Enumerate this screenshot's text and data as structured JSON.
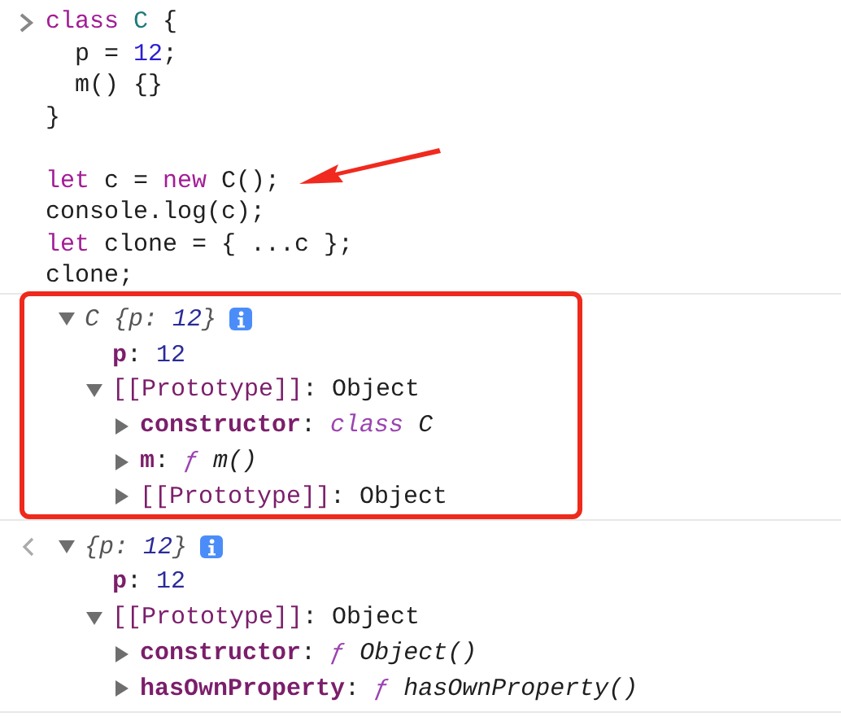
{
  "input": {
    "lines": [
      {
        "segments": [
          {
            "text": "class ",
            "kind": "keyword"
          },
          {
            "text": "C",
            "kind": "name"
          },
          {
            "text": " {",
            "kind": "plain"
          }
        ]
      },
      {
        "segments": [
          {
            "text": "  p = ",
            "kind": "plain"
          },
          {
            "text": "12",
            "kind": "number"
          },
          {
            "text": ";",
            "kind": "plain"
          }
        ]
      },
      {
        "segments": [
          {
            "text": "  m() {}",
            "kind": "plain"
          }
        ]
      },
      {
        "segments": [
          {
            "text": "}",
            "kind": "plain"
          }
        ]
      },
      {
        "gap_before": true,
        "segments": [
          {
            "text": "let",
            "kind": "keyword"
          },
          {
            "text": " c = ",
            "kind": "plain"
          },
          {
            "text": "new",
            "kind": "keyword"
          },
          {
            "text": " C();",
            "kind": "plain"
          }
        ]
      },
      {
        "segments": [
          {
            "text": "console.log(c);",
            "kind": "plain"
          }
        ]
      },
      {
        "segments": [
          {
            "text": "let",
            "kind": "keyword"
          },
          {
            "text": " clone = { ...c };",
            "kind": "plain"
          }
        ]
      },
      {
        "segments": [
          {
            "text": "clone;",
            "kind": "plain"
          }
        ]
      }
    ]
  },
  "outputs": [
    {
      "kind": "log",
      "tree": {
        "expanded": true,
        "info": true,
        "parts": [
          {
            "text": "C {p: ",
            "kind": "preview"
          },
          {
            "text": "12",
            "kind": "preview-number"
          },
          {
            "text": "}",
            "kind": "preview"
          }
        ],
        "children": [
          {
            "parts": [
              {
                "text": "p",
                "kind": "key"
              },
              {
                "text": ": ",
                "kind": "plain"
              },
              {
                "text": "12",
                "kind": "number"
              }
            ]
          },
          {
            "expanded": true,
            "parts": [
              {
                "text": "[[Prototype]]",
                "kind": "internal"
              },
              {
                "text": ": Object",
                "kind": "plain"
              }
            ],
            "children": [
              {
                "expanded": false,
                "parts": [
                  {
                    "text": "constructor",
                    "kind": "key"
                  },
                  {
                    "text": ": ",
                    "kind": "plain"
                  },
                  {
                    "text": "class",
                    "kind": "fn"
                  },
                  {
                    "text": " C",
                    "kind": "fn-name"
                  }
                ]
              },
              {
                "expanded": false,
                "parts": [
                  {
                    "text": "m",
                    "kind": "key"
                  },
                  {
                    "text": ": ",
                    "kind": "plain"
                  },
                  {
                    "text": "ƒ",
                    "kind": "fn"
                  },
                  {
                    "text": " m()",
                    "kind": "fn-name"
                  }
                ]
              },
              {
                "expanded": false,
                "parts": [
                  {
                    "text": "[[Prototype]]",
                    "kind": "internal"
                  },
                  {
                    "text": ": Object",
                    "kind": "plain"
                  }
                ]
              }
            ]
          }
        ]
      }
    },
    {
      "kind": "result",
      "tree": {
        "expanded": true,
        "info": true,
        "parts": [
          {
            "text": "{p: ",
            "kind": "preview"
          },
          {
            "text": "12",
            "kind": "preview-number"
          },
          {
            "text": "}",
            "kind": "preview"
          }
        ],
        "children": [
          {
            "parts": [
              {
                "text": "p",
                "kind": "key"
              },
              {
                "text": ": ",
                "kind": "plain"
              },
              {
                "text": "12",
                "kind": "number"
              }
            ]
          },
          {
            "expanded": true,
            "parts": [
              {
                "text": "[[Prototype]]",
                "kind": "internal"
              },
              {
                "text": ": Object",
                "kind": "plain"
              }
            ],
            "children": [
              {
                "expanded": false,
                "parts": [
                  {
                    "text": "constructor",
                    "kind": "key"
                  },
                  {
                    "text": ": ",
                    "kind": "plain"
                  },
                  {
                    "text": "ƒ",
                    "kind": "fn"
                  },
                  {
                    "text": " Object()",
                    "kind": "fn-name"
                  }
                ]
              },
              {
                "expanded": false,
                "parts": [
                  {
                    "text": "hasOwnProperty",
                    "kind": "key"
                  },
                  {
                    "text": ": ",
                    "kind": "plain"
                  },
                  {
                    "text": "ƒ",
                    "kind": "fn"
                  },
                  {
                    "text": " hasOwnProperty()",
                    "kind": "fn-name"
                  }
                ]
              }
            ]
          }
        ]
      }
    }
  ]
}
